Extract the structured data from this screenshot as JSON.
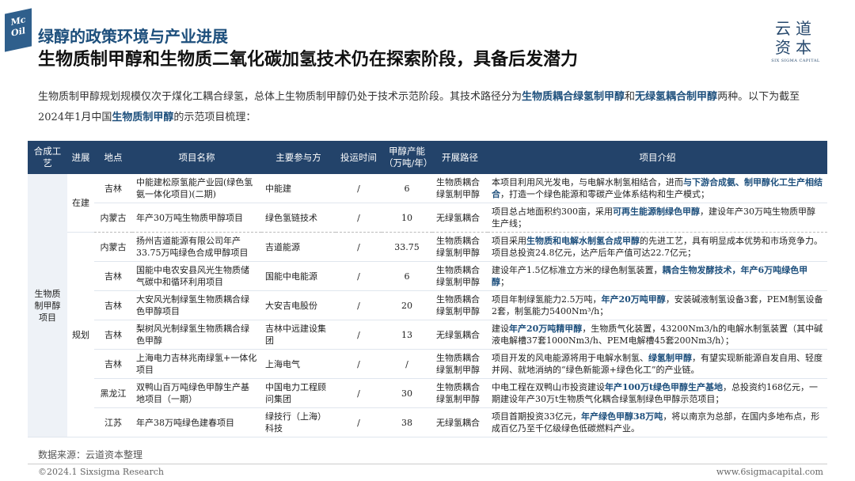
{
  "header": {
    "badge_line1": "Mc",
    "badge_line2": "Oil",
    "title": "绿醇的政策环境与产业进展",
    "subtitle": "生物质制甲醇和生物质二氧化碳加氢技术仍在探索阶段，具备后发潜力",
    "brand_cn": "云道资本",
    "brand_en": "SIX SIGMA CAPITAL"
  },
  "intro": {
    "p1": "生物质制甲醇规划规模仅次于煤化工耦合绿氢，总体上生物质制甲醇仍处于技术示范阶段。其技术路径分为",
    "b1": "生物质耦合绿氢制甲醇",
    "p2": "和",
    "b2": "无绿氢耦合制甲醇",
    "p3": "两种。以下为截至2024年1月中国",
    "b3": "生物质制甲醇",
    "p4": "的示范项目梳理："
  },
  "table": {
    "headers": [
      "合成工艺",
      "进展",
      "地点",
      "项目名称",
      "主要参与方",
      "投运时间",
      "甲醇产能（万吨/年）",
      "开展路径",
      "项目介绍"
    ],
    "category": "生物质制甲醇项目",
    "status_built": "在建",
    "status_planned": "规划",
    "rows": [
      {
        "loc": "吉林",
        "name": "中能建松原氢能产业园(绿色氢氨一体化项目)(二期)",
        "party": "中能建",
        "time": "/",
        "cap": "6",
        "path": "生物质耦合绿氢制甲醇",
        "d1": "本项目利用风光发电，与电解水制氢相结合，进而",
        "d2": "与下游合成氨、制甲醇化工生产相结合",
        "d3": "，打造一个绿色能源和零碳产业体系结构和生产模式；"
      },
      {
        "loc": "内蒙古",
        "name": "年产30万吨生物质甲醇项目",
        "party": "绿色氢链技术",
        "time": "/",
        "cap": "10",
        "path": "无绿氢耦合",
        "d1": "项目总占地面积约300亩，采用",
        "d2": "可再生能源制绿色甲醇",
        "d3": "，建设年产30万吨生物质甲醇生产线；"
      },
      {
        "loc": "内蒙古",
        "name": "扬州吉道能源有限公司年产33.75万吨绿色合成甲醇项目",
        "party": "吉道能源",
        "time": "/",
        "cap": "33.75",
        "path": "生物质耦合绿氢制甲醇",
        "d1": "项目采用",
        "d2": "生物质和电解水制氢合成甲醇",
        "d3": "的先进工艺，具有明显成本优势和市场竞争力。项目总投资24.8亿元，达产后年产值可达22.7亿元；"
      },
      {
        "loc": "吉林",
        "name": "国能中电农安县风光生物质储气碳中和循环利用项目",
        "party": "国能中电能源",
        "time": "/",
        "cap": "6",
        "path": "生物质耦合绿氢制甲醇",
        "d1": "建设年产1.5亿标准立方米的绿色制氢装置，",
        "d2": "耦合生物发酵技术，年产6万吨绿色甲醇",
        "d3": "；"
      },
      {
        "loc": "吉林",
        "name": "大安风光制绿氢生物质耦合绿色甲醇项目",
        "party": "大安吉电股份",
        "time": "/",
        "cap": "20",
        "path": "生物质耦合绿氢制甲醇",
        "d1": "项目年制绿氢能力2.5万吨，",
        "d2": "年产20万吨甲醇",
        "d3": "，安装碱液制氢设备3套，PEM制氢设备2套，制氢能力5400Nm³/h；"
      },
      {
        "loc": "吉林",
        "name": "梨树风光制绿氢生物质耦合绿色甲醇",
        "party": "吉林中远建设集团",
        "time": "/",
        "cap": "13",
        "path": "无绿氢耦合",
        "d1": "建设",
        "d2": "年产20万吨精甲醇",
        "d3": "，生物质气化装置，43200Nm3/h的电解水制氢装置（其中碱液电解槽37套1000Nm3/h、PEM电解槽45套200Nm3/h）；"
      },
      {
        "loc": "吉林",
        "name": "上海电力吉林兆南绿氢+一体化项目",
        "party": "上海电气",
        "time": "/",
        "cap": "/",
        "path": "生物质耦合绿氢制甲醇",
        "d1": "项目开发的风电能源将用于电解水制氢、",
        "d2": "绿氢制甲醇",
        "d3": "，有望实现新能源自发自用、轻度并网、就地消纳的“绿色新能源+绿色化工”的产业链。"
      },
      {
        "loc": "黑龙江",
        "name": "双鸭山百万吨绿色甲醇生产基地项目（一期）",
        "party": "中国电力工程顾问集团",
        "time": "/",
        "cap": "30",
        "path": "生物质耦合绿氢制甲醇",
        "d1": "中电工程在双鸭山市投资建设",
        "d2": "年产100万t绿色甲醇生产基地",
        "d3": "，总投资约168亿元，一期建设年产30万t生物质气化耦合绿氢制绿色甲醇示范项目；"
      },
      {
        "loc": "江苏",
        "name": "年产38万吨绿色建春项目",
        "party": "绿技行（上海）科技",
        "time": "/",
        "cap": "38",
        "path": "无绿氢耦合",
        "d1": "项目首期投资33亿元，",
        "d2": "年产绿色甲醇38万吨",
        "d3": "，将以南京为总部，在国内多地布点，形成百亿乃至千亿级绿色低碳燃料产业。"
      }
    ]
  },
  "source": "数据来源：云道资本整理",
  "footer": {
    "left": "©2024.1 Sixsigma Research",
    "right": "www.6sigmacapital.com"
  }
}
